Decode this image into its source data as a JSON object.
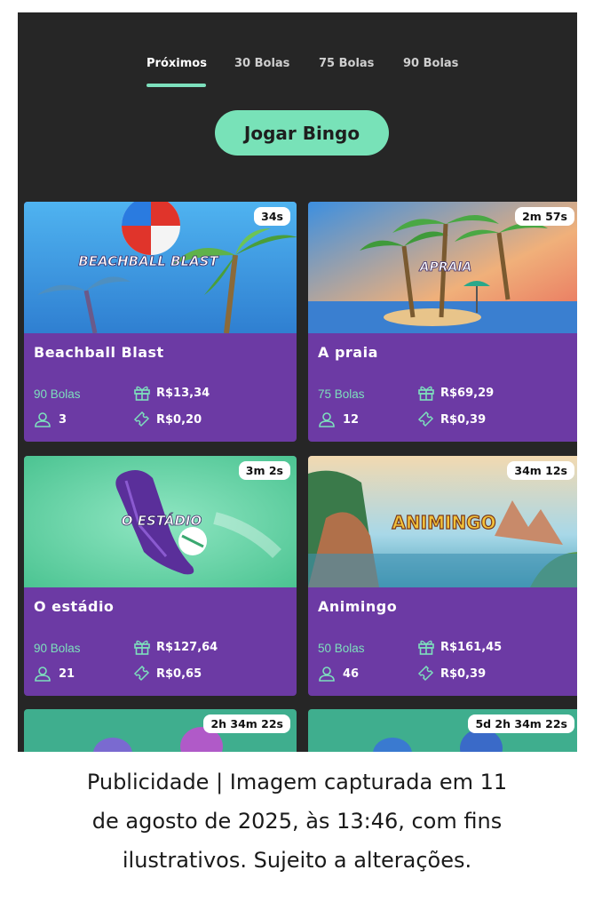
{
  "tabs": [
    {
      "label": "Próximos",
      "active": true
    },
    {
      "label": "30 Bolas",
      "active": false
    },
    {
      "label": "75 Bolas",
      "active": false
    },
    {
      "label": "90 Bolas",
      "active": false
    }
  ],
  "cta": {
    "label": "Jogar Bingo"
  },
  "colors": {
    "accent": "#7de0bd",
    "card_bg": "#6c3aa4",
    "screen_bg": "#262626"
  },
  "cards": [
    {
      "timer": "34s",
      "image_logo": "BEACHBALL BLAST",
      "name": "Beachball Blast",
      "balls": "90 Bolas",
      "players": "3",
      "prize": "R$13,34",
      "price": "R$0,20"
    },
    {
      "timer": "2m 57s",
      "image_logo": "APRAIA",
      "name": "A praia",
      "balls": "75 Bolas",
      "players": "12",
      "prize": "R$69,29",
      "price": "R$0,39"
    },
    {
      "timer": "3m 2s",
      "image_logo": "O ESTÁDIO",
      "name": "O estádio",
      "balls": "90 Bolas",
      "players": "21",
      "prize": "R$127,64",
      "price": "R$0,65"
    },
    {
      "timer": "34m 12s",
      "image_logo": "ANIMINGO",
      "name": "Animingo",
      "balls": "50 Bolas",
      "players": "46",
      "prize": "R$161,45",
      "price": "R$0,39"
    },
    {
      "timer": "2h 34m 22s"
    },
    {
      "timer": "5d 2h 34m 22s"
    }
  ],
  "caption": {
    "line1": "Publicidade | Imagem capturada em 11",
    "line2": "de agosto de 2025, às 13:46, com fins",
    "line3": "ilustrativos. Sujeito a alterações."
  }
}
